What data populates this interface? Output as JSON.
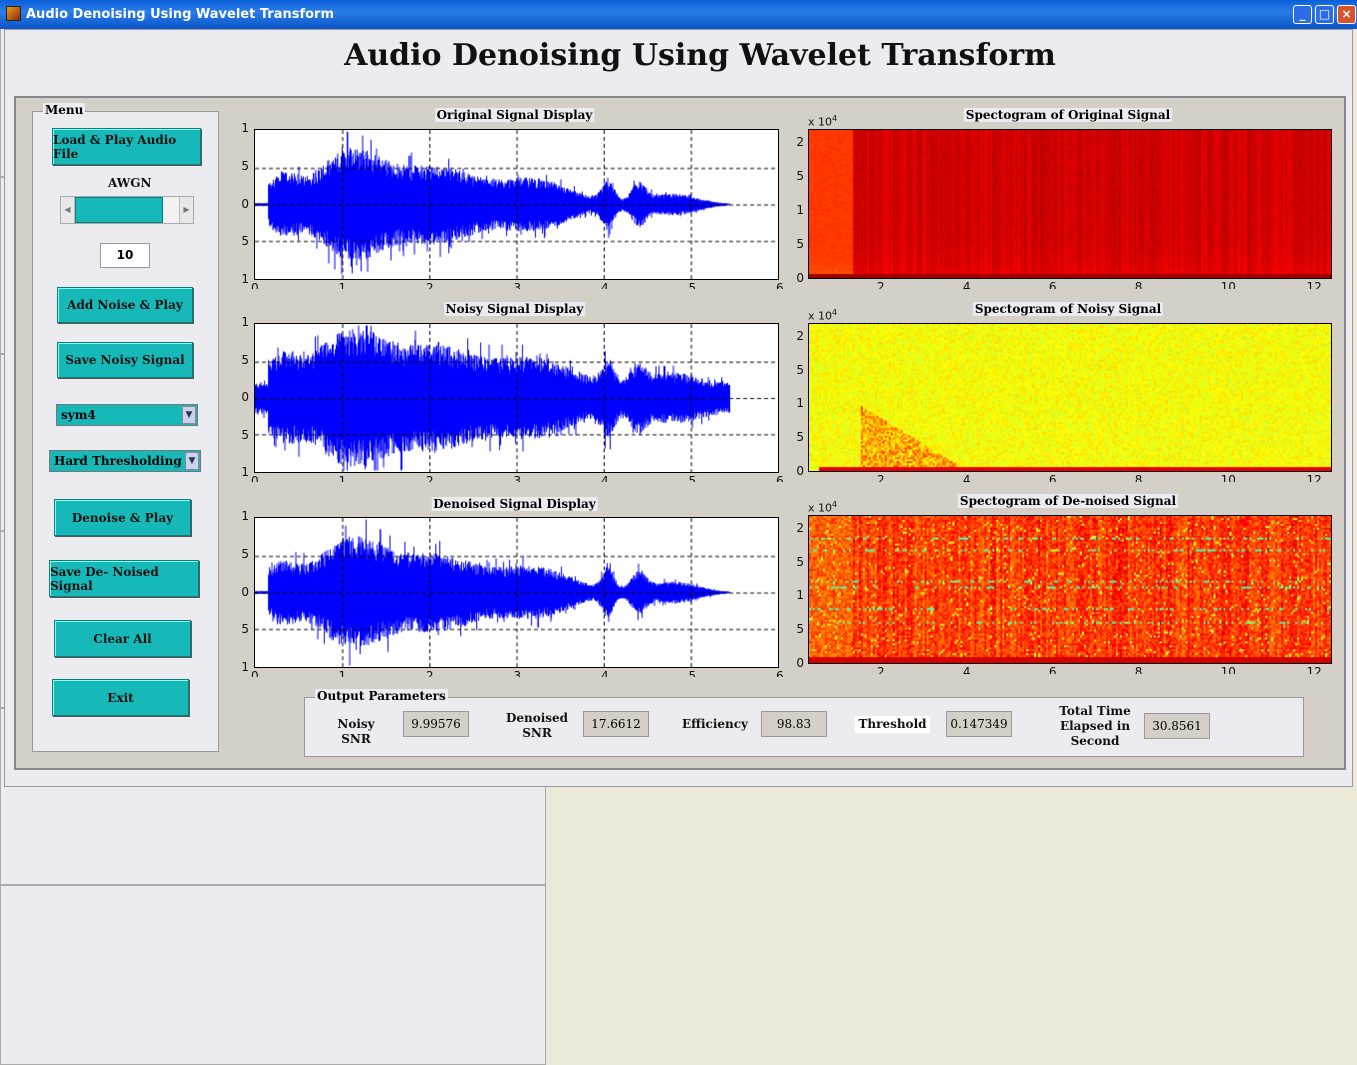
{
  "window": {
    "title": "Audio Denoising Using Wavelet Transform",
    "controls": [
      "minimize",
      "maximize",
      "close"
    ]
  },
  "header": {
    "title": "Audio Denoising Using Wavelet Transform"
  },
  "menu": {
    "title": "Menu",
    "load_button": "Load & Play Audio File",
    "awgn_label": "AWGN",
    "awgn_slider_fraction": 0.85,
    "awgn_value": "10",
    "add_noise_button": "Add Noise & Play",
    "save_noisy_button": "Save Noisy Signal",
    "wavelet_select": "sym4",
    "threshold_select": "Hard Thresholding",
    "denoise_button": "Denoise & Play",
    "save_denoised_button": "Save De- Noised Signal",
    "clear_button": "Clear All",
    "exit_button": "Exit"
  },
  "plots": {
    "original": {
      "title": "Original Signal Display"
    },
    "noisy": {
      "title": "Noisy Signal Display"
    },
    "denoised": {
      "title": "Denoised Signal Display"
    },
    "spec_original": {
      "title": "Spectogram of Original Signal",
      "exponent": "x 10",
      "exp_power": "4"
    },
    "spec_noisy": {
      "title": "Spectogram of Noisy Signal",
      "exponent": "x 10",
      "exp_power": "4"
    },
    "spec_denoised": {
      "title": "Spectogram of De-noised Signal",
      "exponent": "x 10",
      "exp_power": "4"
    }
  },
  "chart_data": [
    {
      "type": "line",
      "title": "Original Signal Display",
      "xlim": [
        0,
        6
      ],
      "ylim": [
        -1,
        1
      ],
      "x_ticks": [
        "0",
        "1",
        "2",
        "3",
        "4",
        "5",
        "6"
      ],
      "y_ticks": [
        "1",
        "5",
        "0",
        "5",
        "1"
      ],
      "grid": true,
      "color": "#0000ff",
      "signal_end": 5.45
    },
    {
      "type": "line",
      "title": "Noisy Signal Display",
      "xlim": [
        0,
        6
      ],
      "ylim": [
        -1,
        1
      ],
      "x_ticks": [
        "0",
        "1",
        "2",
        "3",
        "4",
        "5",
        "6"
      ],
      "y_ticks": [
        "1",
        "5",
        "0",
        "5",
        "1"
      ],
      "grid": true,
      "color": "#0000ff",
      "signal_end": 5.45
    },
    {
      "type": "line",
      "title": "Denoised Signal Display",
      "xlim": [
        0,
        6
      ],
      "ylim": [
        -1,
        1
      ],
      "x_ticks": [
        "0",
        "1",
        "2",
        "3",
        "4",
        "5",
        "6"
      ],
      "y_ticks": [
        "1",
        "5",
        "0",
        "5",
        "1"
      ],
      "grid": true,
      "color": "#0000ff",
      "signal_end": 5.45
    },
    {
      "type": "heatmap",
      "title": "Spectogram of Original Signal",
      "xlim": [
        0.3,
        12.5
      ],
      "ylim": [
        0,
        22050
      ],
      "x_ticks": [
        "2",
        "4",
        "6",
        "8",
        "10",
        "12"
      ],
      "y_ticks": [
        "2",
        "5",
        "1",
        "5",
        "0"
      ]
    },
    {
      "type": "heatmap",
      "title": "Spectogram of Noisy Signal",
      "xlim": [
        0.3,
        12.5
      ],
      "ylim": [
        0,
        22050
      ],
      "x_ticks": [
        "2",
        "4",
        "6",
        "8",
        "10",
        "12"
      ],
      "y_ticks": [
        "2",
        "5",
        "1",
        "5",
        "0"
      ]
    },
    {
      "type": "heatmap",
      "title": "Spectogram of De-noised Signal",
      "xlim": [
        0.3,
        12.5
      ],
      "ylim": [
        0,
        22050
      ],
      "x_ticks": [
        "2",
        "4",
        "6",
        "8",
        "10",
        "12"
      ],
      "y_ticks": [
        "2",
        "5",
        "1",
        "5",
        "0"
      ]
    }
  ],
  "output": {
    "title": "Output Parameters",
    "noisy_snr_label": "Noisy SNR",
    "noisy_snr": "9.99576",
    "denoised_snr_label1": "Denoised",
    "denoised_snr_label2": "SNR",
    "denoised_snr": "17.6612",
    "efficiency_label": "Efficiency",
    "efficiency": "98.83",
    "threshold_label": "Threshold",
    "threshold": "0.147349",
    "time_label1": "Total Time",
    "time_label2": "Elapsed in",
    "time_label3": "Second",
    "time": "30.8561"
  }
}
